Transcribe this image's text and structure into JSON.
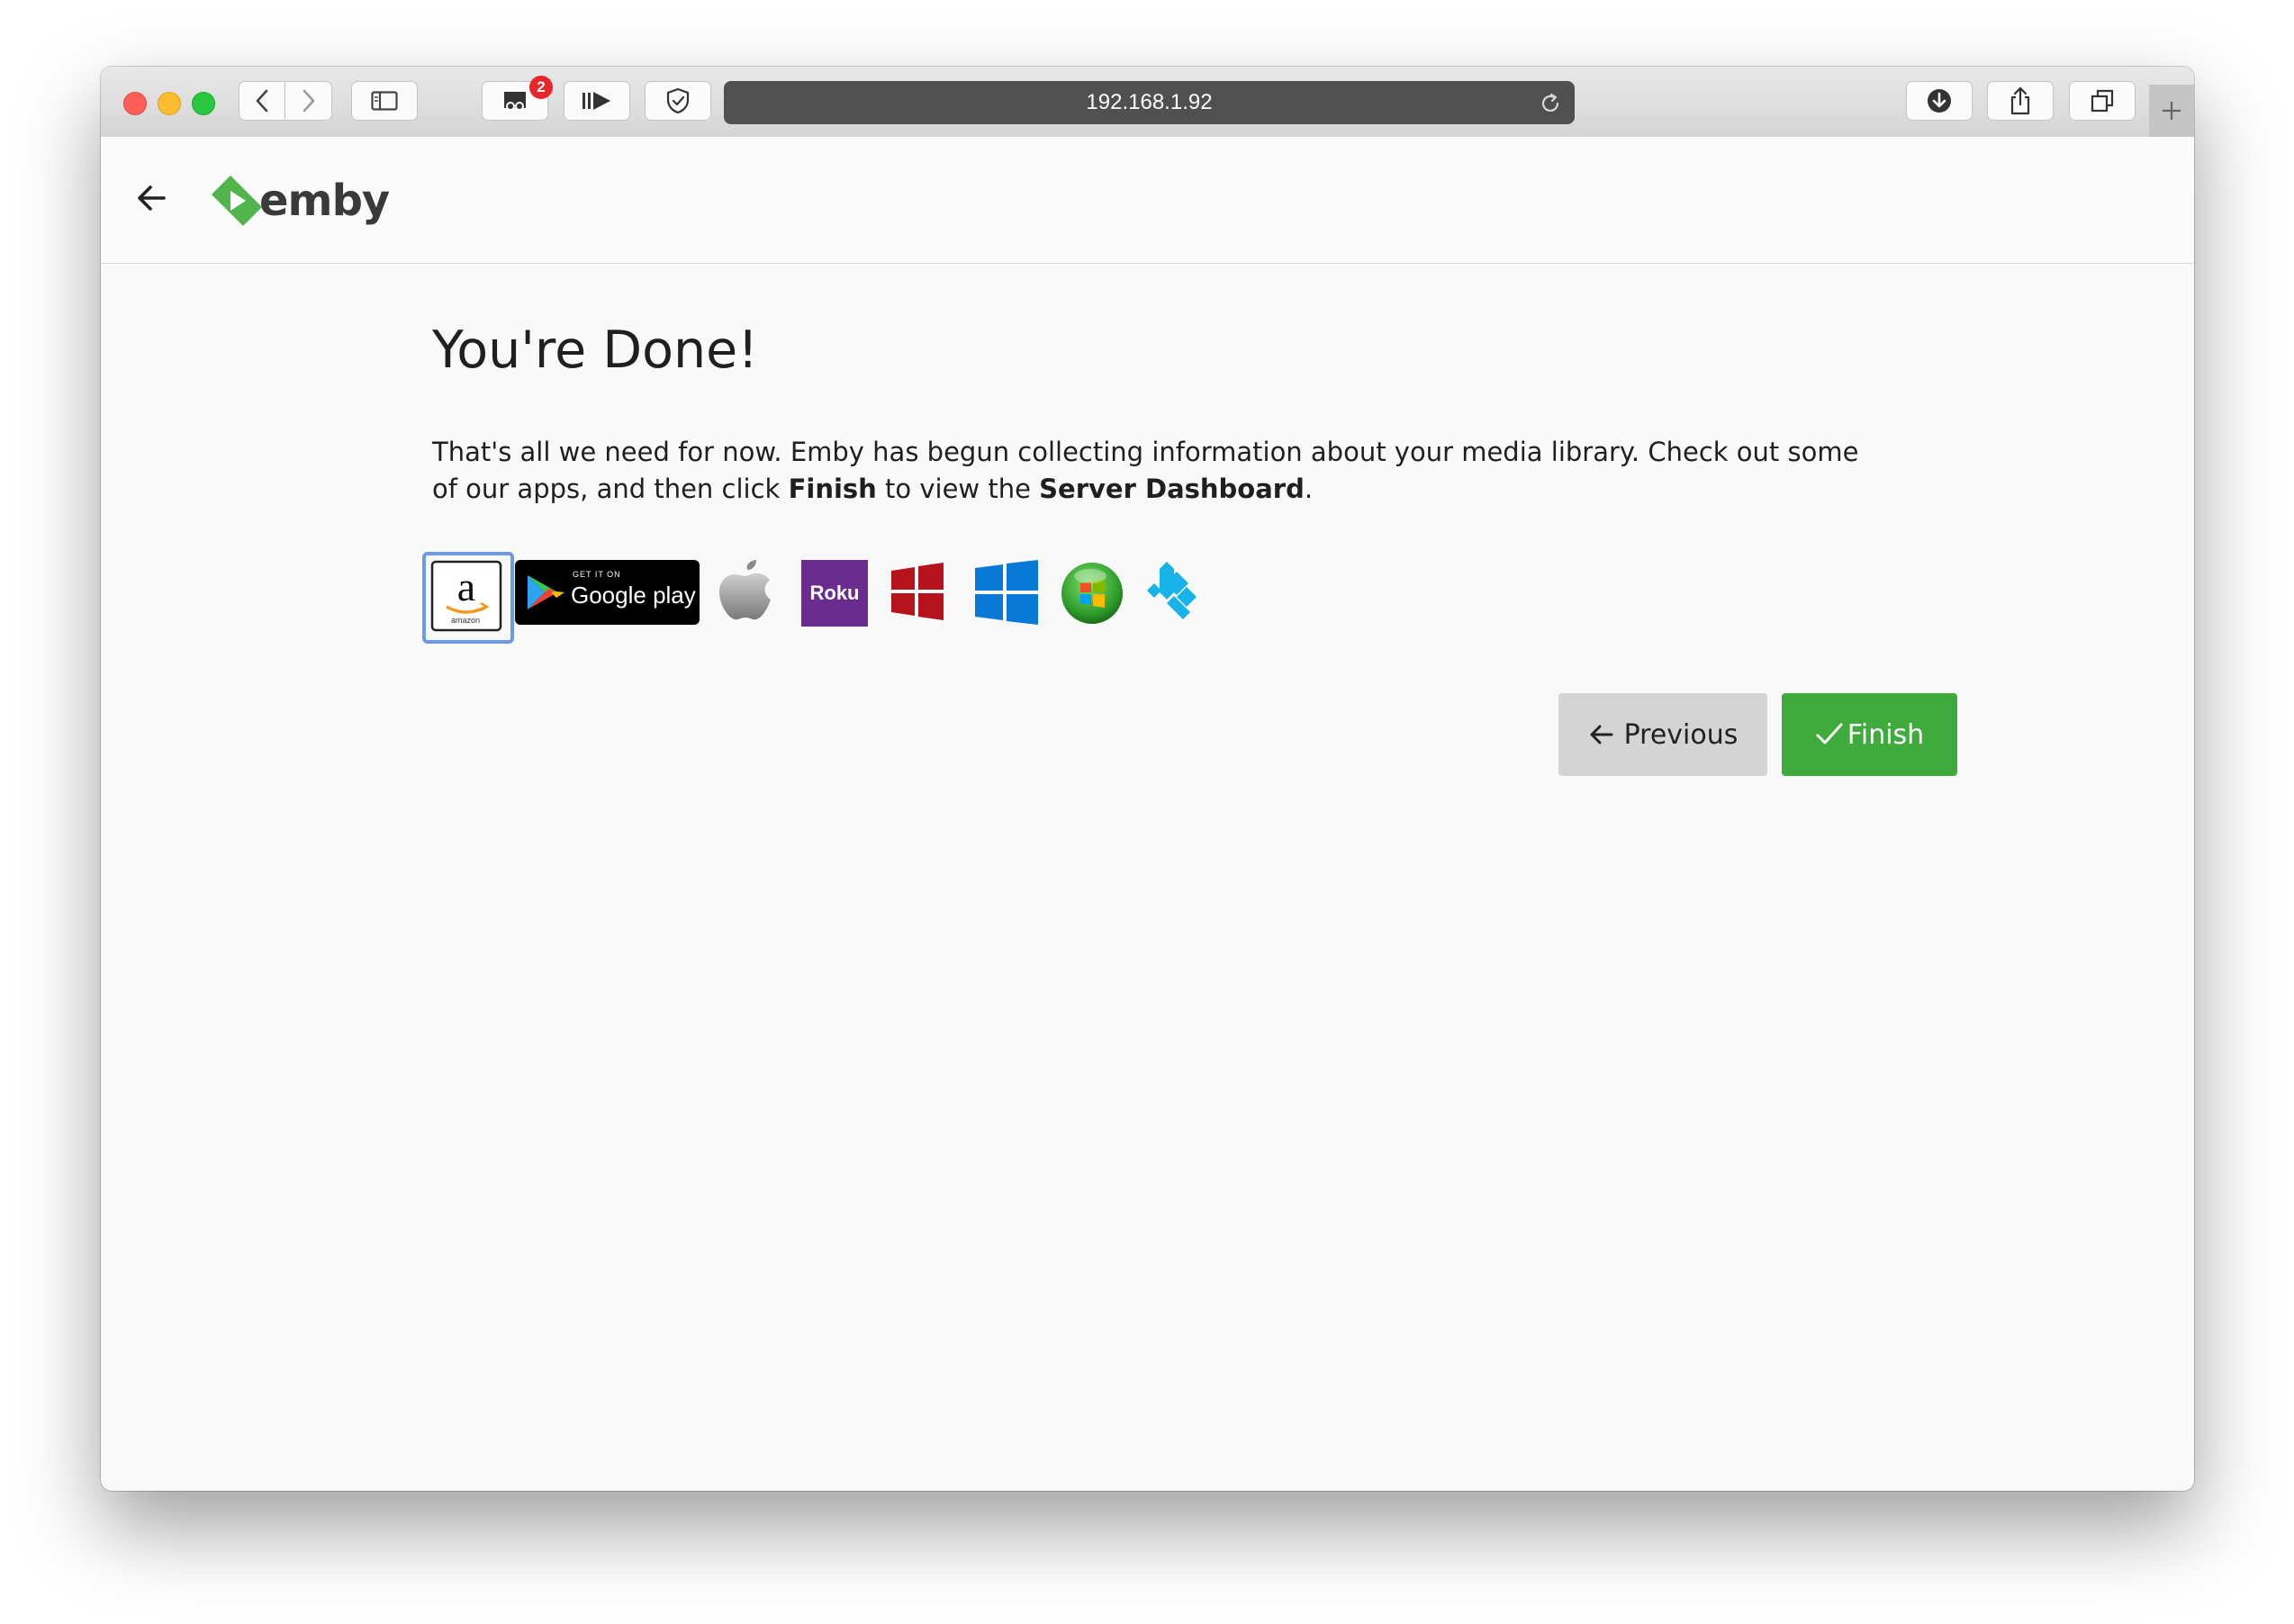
{
  "browser": {
    "url": "192.168.1.92",
    "extension_badge_count": "2",
    "icons": [
      "back-chevron-icon",
      "forward-chevron-icon",
      "sidebar-icon",
      "extension-icon",
      "media-icon",
      "shield-icon",
      "reload-icon",
      "download-icon",
      "share-icon",
      "tabs-icon",
      "new-tab-icon"
    ]
  },
  "app": {
    "logo_text": "emby",
    "brand_color": "#52b54b"
  },
  "page": {
    "title": "You're Done!",
    "paragraph_part1": "That's all we need for now. Emby has begun collecting information about your media library. Check out some of our apps, and then click ",
    "paragraph_bold1": "Finish",
    "paragraph_part2": " to view the ",
    "paragraph_bold2": "Server Dashboard",
    "paragraph_part3": "."
  },
  "apps": {
    "amazon_label": "amazon",
    "google_small": "GET IT ON",
    "google_big": "Google play",
    "roku_label": "Roku"
  },
  "buttons": {
    "previous_label": "Previous",
    "finish_label": "Finish"
  },
  "colors": {
    "finish_green": "#3fab3d",
    "previous_gray": "#d4d4d4",
    "url_bar": "#505050",
    "badge_red": "#e8262b"
  }
}
